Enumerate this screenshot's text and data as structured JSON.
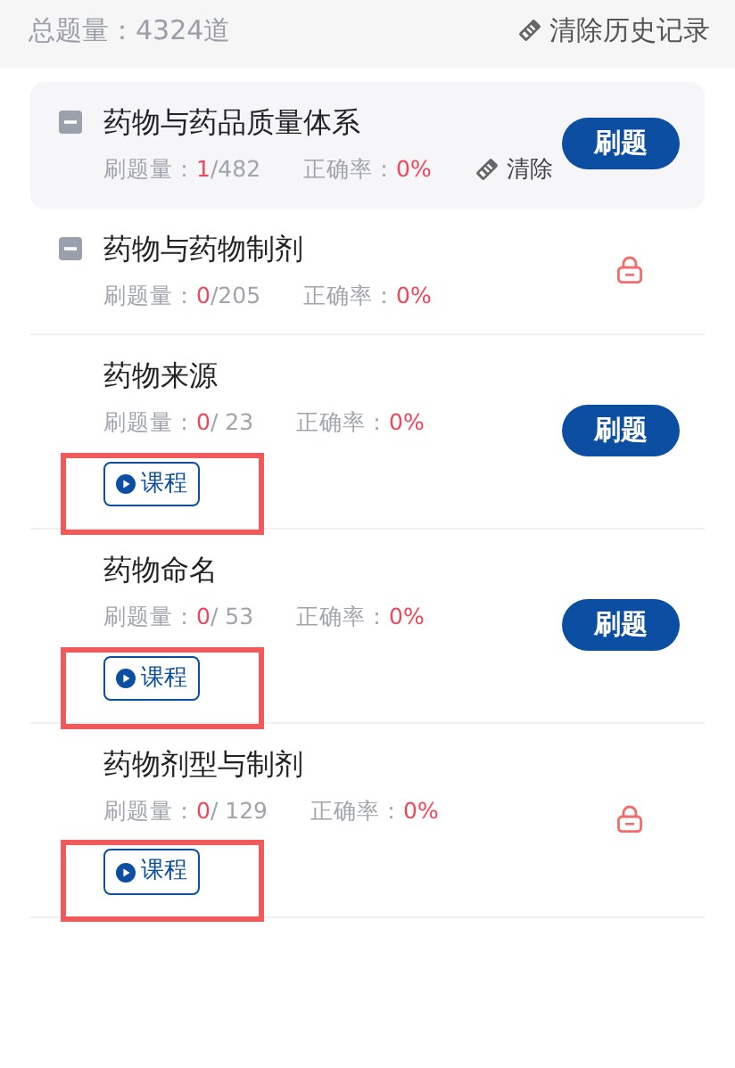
{
  "header": {
    "total": "总题量：4324道",
    "clear_all": "清除历史记录"
  },
  "rows": [
    {
      "kind": "chapter",
      "selected": true,
      "title": "药物与药品质量体系",
      "count_label": "刷题量：",
      "done": "1",
      "total": "/482",
      "accuracy_label": "正确率：",
      "accuracy": "0%",
      "clear": "清除",
      "action": {
        "kind": "button",
        "label": "刷题"
      }
    },
    {
      "kind": "chapter",
      "selected": false,
      "title": "药物与药物制剂",
      "count_label": "刷题量：",
      "done": "0",
      "total": "/205",
      "accuracy_label": "正确率：",
      "accuracy": "0%",
      "action": {
        "kind": "locked"
      }
    },
    {
      "kind": "section",
      "selected": false,
      "title": "药物来源",
      "count_label": "刷题量：",
      "done": "0",
      "total": "/ 23",
      "accuracy_label": "正确率：",
      "accuracy": "0%",
      "course": {
        "label": "课程",
        "highlighted": true
      },
      "action": {
        "kind": "button",
        "label": "刷题"
      }
    },
    {
      "kind": "section",
      "selected": false,
      "title": "药物命名",
      "count_label": "刷题量：",
      "done": "0",
      "total": "/ 53",
      "accuracy_label": "正确率：",
      "accuracy": "0%",
      "course": {
        "label": "课程",
        "highlighted": true
      },
      "action": {
        "kind": "button",
        "label": "刷题"
      }
    },
    {
      "kind": "section",
      "selected": false,
      "title": "药物剂型与制剂",
      "count_label": "刷题量：",
      "done": "0",
      "total": "/ 129",
      "accuracy_label": "正确率：",
      "accuracy": "0%",
      "course": {
        "label": "课程",
        "highlighted": true
      },
      "action": {
        "kind": "locked"
      }
    }
  ]
}
